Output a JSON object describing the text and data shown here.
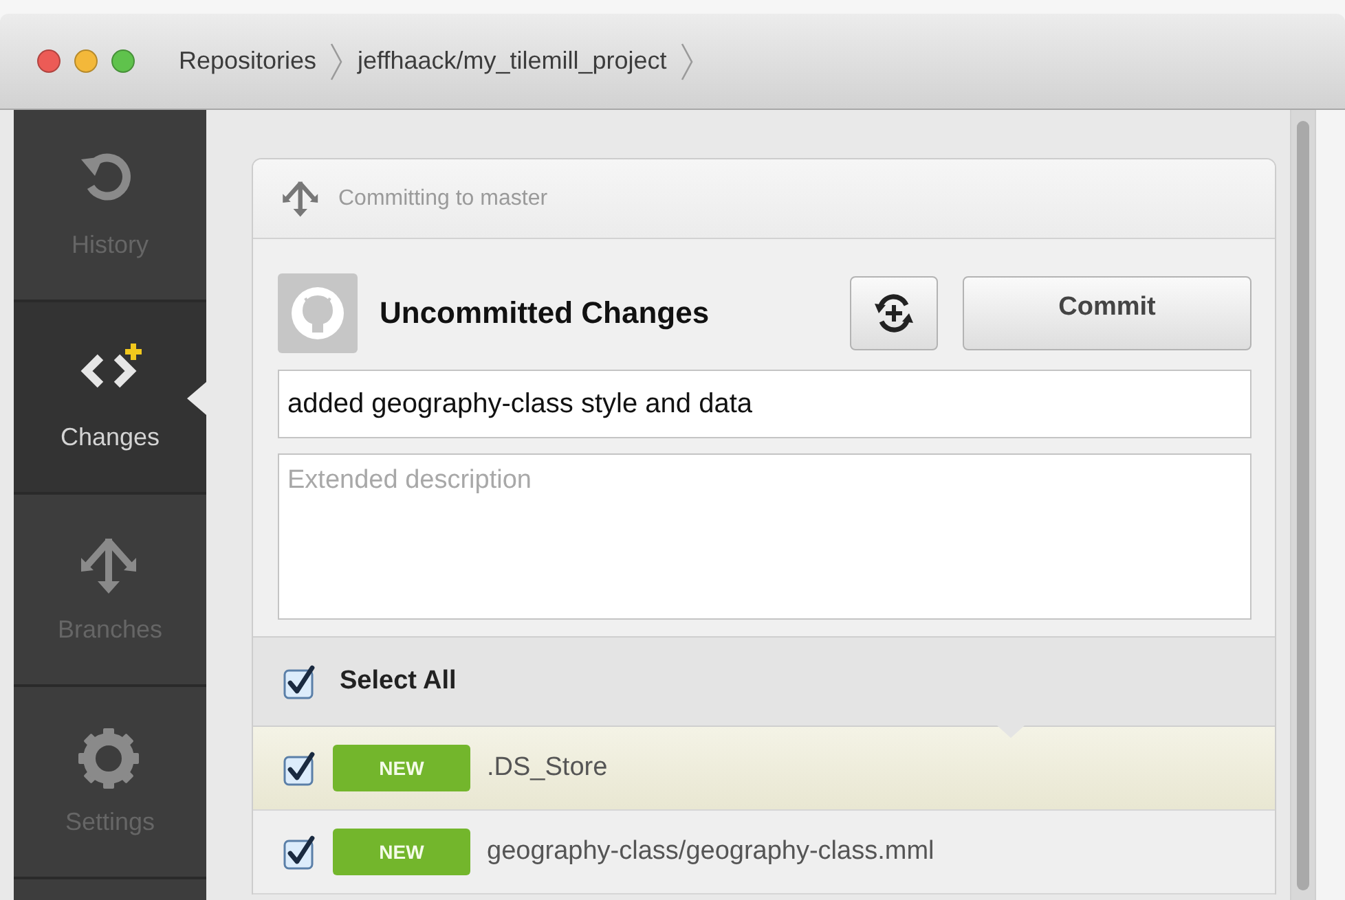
{
  "window": {
    "breadcrumbs": [
      "Repositories",
      "jeffhaack/my_tilemill_project"
    ]
  },
  "sidebar": {
    "items": [
      {
        "kind": "history",
        "label": "History",
        "selected": false
      },
      {
        "kind": "changes",
        "label": "Changes",
        "selected": true
      },
      {
        "kind": "branches",
        "label": "Branches",
        "selected": false
      },
      {
        "kind": "settings",
        "label": "Settings",
        "selected": false
      }
    ]
  },
  "commit": {
    "branch_label": "Committing to master",
    "title": "Uncommitted Changes",
    "commit_button": "Commit",
    "summary": {
      "value": "added geography-class style and data"
    },
    "description": {
      "placeholder": "Extended description"
    }
  },
  "files": {
    "select_all": {
      "label": "Select All",
      "checked": true
    },
    "items": [
      {
        "status": "NEW",
        "path": ".DS_Store",
        "checked": true,
        "selected": true
      },
      {
        "status": "NEW",
        "path": "geography-class/geography-class.mml",
        "checked": true,
        "selected": false
      }
    ]
  }
}
